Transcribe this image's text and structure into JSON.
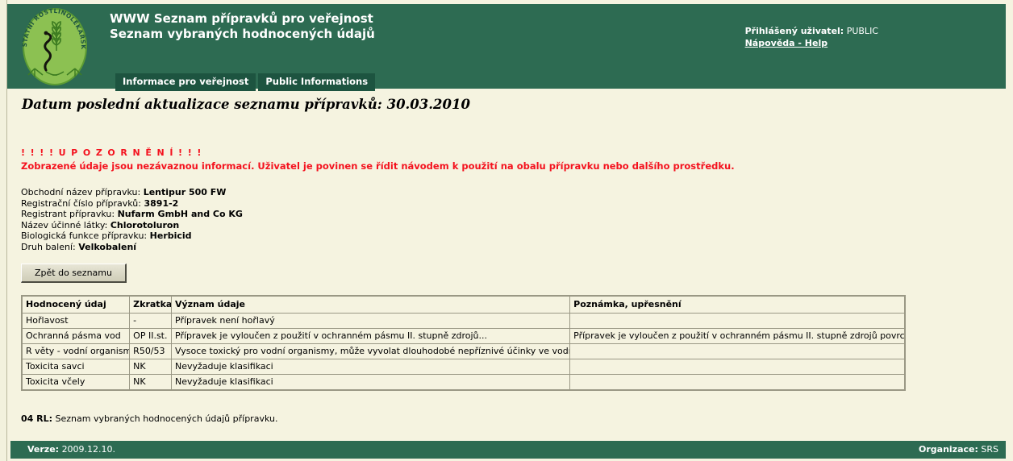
{
  "header": {
    "title_line1": "WWW Seznam přípravků pro veřejnost",
    "title_line2": "Seznam vybraných hodnocených údajů",
    "user_label": "Přihlášený uživatel:",
    "user_value": "PUBLIC",
    "help_link": "Nápověda - Help",
    "logo": {
      "ring_text": "STÁTNÍ ROSTLINOLÉKAŘSKÁ SPRÁVA",
      "oval_color": "#8cc152",
      "header_color": "#2d6b52"
    },
    "tabs": [
      {
        "label": "Informace pro veřejnost"
      },
      {
        "label": "Public Informations"
      }
    ]
  },
  "main": {
    "update_date_text": "Datum poslední aktualizace seznamu přípravků: 30.03.2010",
    "warning_title": "! ! ! ! U P O Z O R N Ě N Í ! ! !",
    "warning_body": "Zobrazené údaje jsou nezávaznou informací. Uživatel je povinen se řídit návodem k použití na obalu přípravku nebo dalšího prostředku.",
    "warning_color": "#f4121e",
    "fields": [
      {
        "label": "Obchodní název přípravku:",
        "value": "Lentipur 500 FW"
      },
      {
        "label": "Registrační číslo přípravků:",
        "value": "3891-2"
      },
      {
        "label": "Registrant přípravku:",
        "value": "Nufarm GmbH and Co KG"
      },
      {
        "label": "Název účinné látky:",
        "value": "Chlorotoluron"
      },
      {
        "label": "Biologická funkce přípravku:",
        "value": "Herbicid"
      },
      {
        "label": "Druh balení:",
        "value": "Velkobalení"
      }
    ],
    "back_button_label": "Zpět do seznamu",
    "table": {
      "columns": [
        "Hodnocený údaj",
        "Zkratka",
        "Význam údaje",
        "Poznámka, upřesnění"
      ],
      "rows": [
        [
          "Hořlavost",
          "-",
          "Přípravek není hořlavý",
          ""
        ],
        [
          "Ochranná pásma vod",
          "OP II.st.",
          "Přípravek je vyloučen z použití v ochranném pásmu II. stupně zdrojů...",
          "Přípravek je vyloučen z použití v ochranném pásmu II. stupně zdrojů povrchové vody"
        ],
        [
          "R věty - vodní organismy",
          "R50/53",
          "Vysoce toxický pro vodní organismy, může vyvolat dlouhodobé nepříznivé účinky ve vodním prostředí",
          ""
        ],
        [
          "Toxicita savci",
          "NK",
          "Nevyžaduje klasifikaci",
          ""
        ],
        [
          "Toxicita včely",
          "NK",
          "Nevyžaduje klasifikaci",
          ""
        ]
      ]
    },
    "footnote_code": "04 RL:",
    "footnote_text": " Seznam vybraných hodnocených údajů přípravku."
  },
  "footer": {
    "version_label": "Verze:",
    "version_value": "2009.12.10.",
    "org_label": "Organizace:",
    "org_value": "SRS",
    "background_color": "#2d6b52"
  }
}
